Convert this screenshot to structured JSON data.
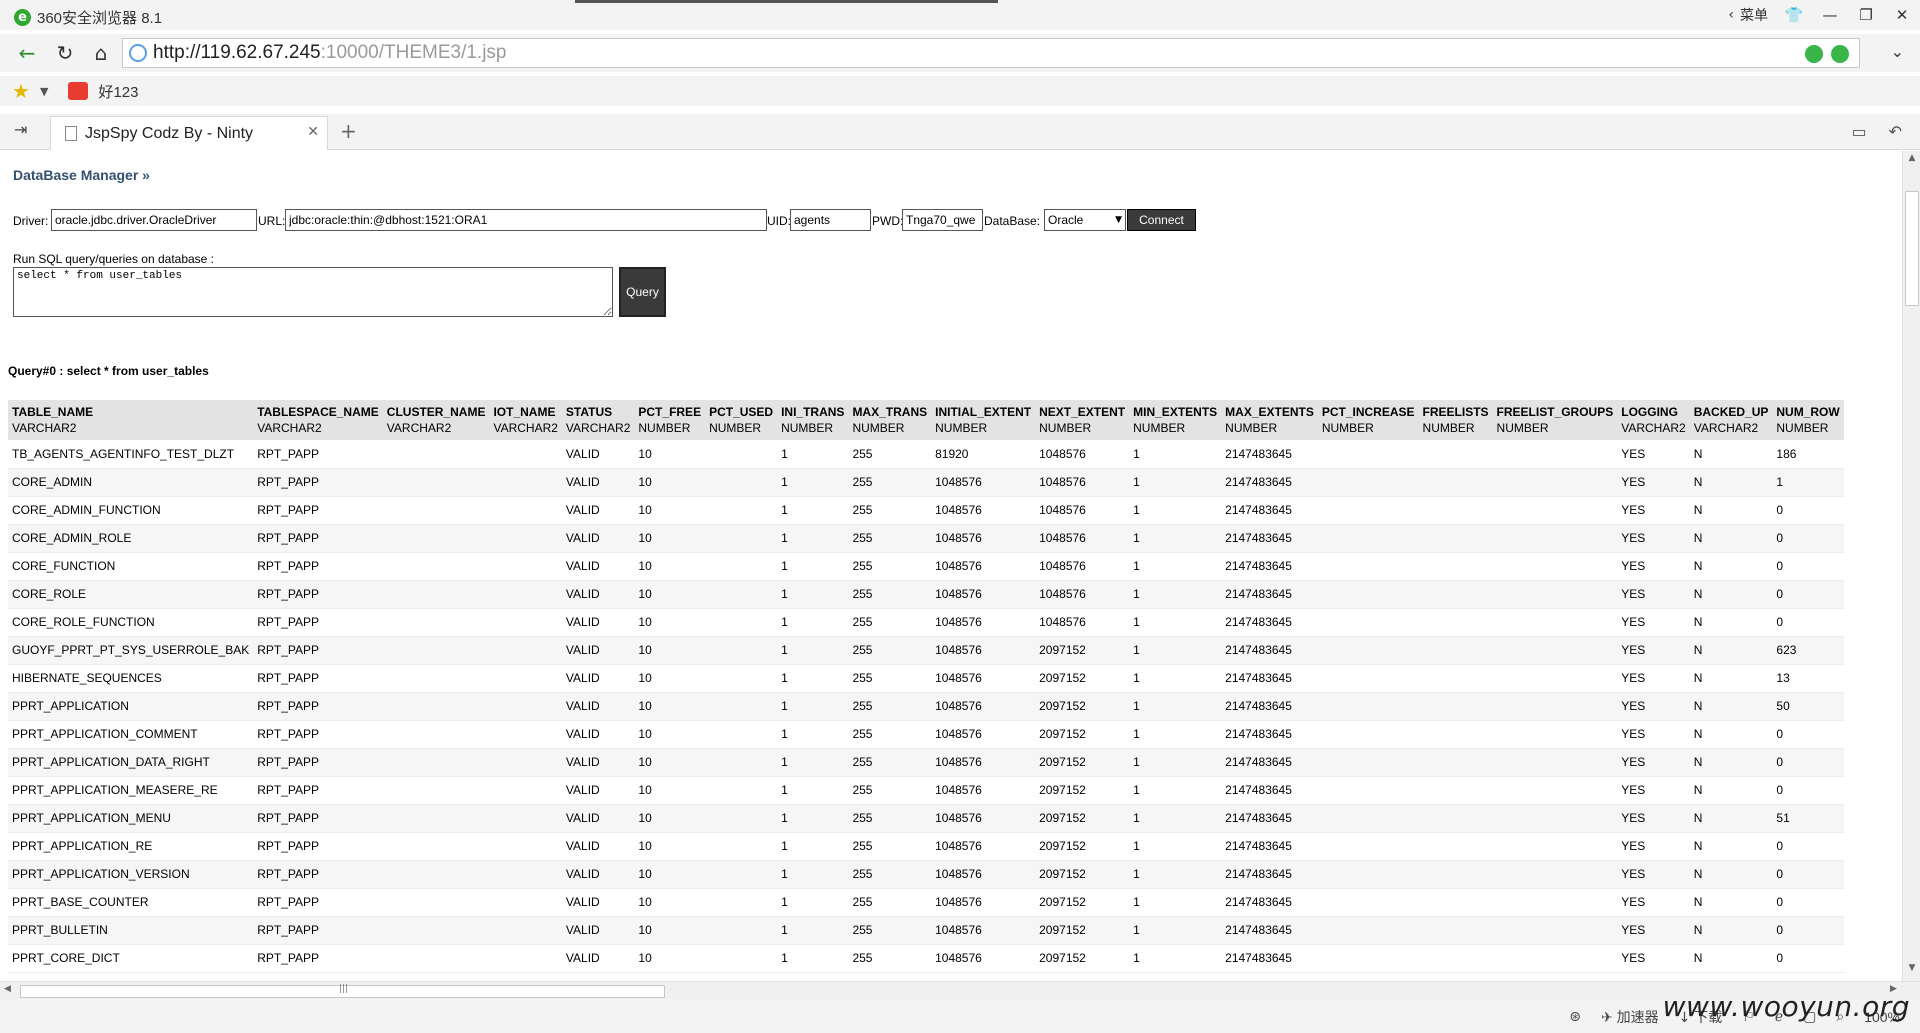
{
  "browser": {
    "title": "360安全浏览器 8.1",
    "menu_label": "菜单",
    "url_host": "http://119.62.67.245",
    "url_path": ":10000/THEME3/1.jsp",
    "fav_label": "好123",
    "tab_title": "JspSpy Codz By - Ninty",
    "status": {
      "accelerator": "加速器",
      "download": "下载",
      "zoom": "100%"
    },
    "watermark": "www.wooyun.org"
  },
  "page": {
    "title": "DataBase Manager »",
    "driver_label": "Driver:",
    "driver_value": "oracle.jdbc.driver.OracleDriver",
    "url_label": "URL:",
    "url_value": "jdbc:oracle:thin:@dbhost:1521:ORA1",
    "uid_label": "UID:",
    "uid_value": "agents",
    "pwd_label": "PWD:",
    "pwd_value": "Tnga70_qwe",
    "db_label": "DataBase:",
    "db_value": "Oracle",
    "connect_label": "Connect",
    "sql_label": "Run SQL query/queries on database :",
    "sql_value": "select * from user_tables",
    "query_label": "Query",
    "query_caption": "Query#0 : select * from user_tables"
  },
  "table": {
    "columns": [
      {
        "name": "TABLE_NAME",
        "type": "VARCHAR2"
      },
      {
        "name": "TABLESPACE_NAME",
        "type": "VARCHAR2"
      },
      {
        "name": "CLUSTER_NAME",
        "type": "VARCHAR2"
      },
      {
        "name": "IOT_NAME",
        "type": "VARCHAR2"
      },
      {
        "name": "STATUS",
        "type": "VARCHAR2"
      },
      {
        "name": "PCT_FREE",
        "type": "NUMBER"
      },
      {
        "name": "PCT_USED",
        "type": "NUMBER"
      },
      {
        "name": "INI_TRANS",
        "type": "NUMBER"
      },
      {
        "name": "MAX_TRANS",
        "type": "NUMBER"
      },
      {
        "name": "INITIAL_EXTENT",
        "type": "NUMBER"
      },
      {
        "name": "NEXT_EXTENT",
        "type": "NUMBER"
      },
      {
        "name": "MIN_EXTENTS",
        "type": "NUMBER"
      },
      {
        "name": "MAX_EXTENTS",
        "type": "NUMBER"
      },
      {
        "name": "PCT_INCREASE",
        "type": "NUMBER"
      },
      {
        "name": "FREELISTS",
        "type": "NUMBER"
      },
      {
        "name": "FREELIST_GROUPS",
        "type": "NUMBER"
      },
      {
        "name": "LOGGING",
        "type": "VARCHAR2"
      },
      {
        "name": "BACKED_UP",
        "type": "VARCHAR2"
      },
      {
        "name": "NUM_ROW",
        "type": "NUMBER"
      }
    ],
    "rows": [
      [
        "TB_AGENTS_AGENTINFO_TEST_DLZT",
        "RPT_PAPP",
        "",
        "",
        "VALID",
        "10",
        "",
        "1",
        "255",
        "81920",
        "1048576",
        "1",
        "2147483645",
        "",
        "",
        "",
        "YES",
        "N",
        "186"
      ],
      [
        "CORE_ADMIN",
        "RPT_PAPP",
        "",
        "",
        "VALID",
        "10",
        "",
        "1",
        "255",
        "1048576",
        "1048576",
        "1",
        "2147483645",
        "",
        "",
        "",
        "YES",
        "N",
        "1"
      ],
      [
        "CORE_ADMIN_FUNCTION",
        "RPT_PAPP",
        "",
        "",
        "VALID",
        "10",
        "",
        "1",
        "255",
        "1048576",
        "1048576",
        "1",
        "2147483645",
        "",
        "",
        "",
        "YES",
        "N",
        "0"
      ],
      [
        "CORE_ADMIN_ROLE",
        "RPT_PAPP",
        "",
        "",
        "VALID",
        "10",
        "",
        "1",
        "255",
        "1048576",
        "1048576",
        "1",
        "2147483645",
        "",
        "",
        "",
        "YES",
        "N",
        "0"
      ],
      [
        "CORE_FUNCTION",
        "RPT_PAPP",
        "",
        "",
        "VALID",
        "10",
        "",
        "1",
        "255",
        "1048576",
        "1048576",
        "1",
        "2147483645",
        "",
        "",
        "",
        "YES",
        "N",
        "0"
      ],
      [
        "CORE_ROLE",
        "RPT_PAPP",
        "",
        "",
        "VALID",
        "10",
        "",
        "1",
        "255",
        "1048576",
        "1048576",
        "1",
        "2147483645",
        "",
        "",
        "",
        "YES",
        "N",
        "0"
      ],
      [
        "CORE_ROLE_FUNCTION",
        "RPT_PAPP",
        "",
        "",
        "VALID",
        "10",
        "",
        "1",
        "255",
        "1048576",
        "1048576",
        "1",
        "2147483645",
        "",
        "",
        "",
        "YES",
        "N",
        "0"
      ],
      [
        "GUOYF_PPRT_PT_SYS_USERROLE_BAK",
        "RPT_PAPP",
        "",
        "",
        "VALID",
        "10",
        "",
        "1",
        "255",
        "1048576",
        "2097152",
        "1",
        "2147483645",
        "",
        "",
        "",
        "YES",
        "N",
        "623"
      ],
      [
        "HIBERNATE_SEQUENCES",
        "RPT_PAPP",
        "",
        "",
        "VALID",
        "10",
        "",
        "1",
        "255",
        "1048576",
        "2097152",
        "1",
        "2147483645",
        "",
        "",
        "",
        "YES",
        "N",
        "13"
      ],
      [
        "PPRT_APPLICATION",
        "RPT_PAPP",
        "",
        "",
        "VALID",
        "10",
        "",
        "1",
        "255",
        "1048576",
        "2097152",
        "1",
        "2147483645",
        "",
        "",
        "",
        "YES",
        "N",
        "50"
      ],
      [
        "PPRT_APPLICATION_COMMENT",
        "RPT_PAPP",
        "",
        "",
        "VALID",
        "10",
        "",
        "1",
        "255",
        "1048576",
        "2097152",
        "1",
        "2147483645",
        "",
        "",
        "",
        "YES",
        "N",
        "0"
      ],
      [
        "PPRT_APPLICATION_DATA_RIGHT",
        "RPT_PAPP",
        "",
        "",
        "VALID",
        "10",
        "",
        "1",
        "255",
        "1048576",
        "2097152",
        "1",
        "2147483645",
        "",
        "",
        "",
        "YES",
        "N",
        "0"
      ],
      [
        "PPRT_APPLICATION_MEASERE_RE",
        "RPT_PAPP",
        "",
        "",
        "VALID",
        "10",
        "",
        "1",
        "255",
        "1048576",
        "2097152",
        "1",
        "2147483645",
        "",
        "",
        "",
        "YES",
        "N",
        "0"
      ],
      [
        "PPRT_APPLICATION_MENU",
        "RPT_PAPP",
        "",
        "",
        "VALID",
        "10",
        "",
        "1",
        "255",
        "1048576",
        "2097152",
        "1",
        "2147483645",
        "",
        "",
        "",
        "YES",
        "N",
        "51"
      ],
      [
        "PPRT_APPLICATION_RE",
        "RPT_PAPP",
        "",
        "",
        "VALID",
        "10",
        "",
        "1",
        "255",
        "1048576",
        "2097152",
        "1",
        "2147483645",
        "",
        "",
        "",
        "YES",
        "N",
        "0"
      ],
      [
        "PPRT_APPLICATION_VERSION",
        "RPT_PAPP",
        "",
        "",
        "VALID",
        "10",
        "",
        "1",
        "255",
        "1048576",
        "2097152",
        "1",
        "2147483645",
        "",
        "",
        "",
        "YES",
        "N",
        "0"
      ],
      [
        "PPRT_BASE_COUNTER",
        "RPT_PAPP",
        "",
        "",
        "VALID",
        "10",
        "",
        "1",
        "255",
        "1048576",
        "2097152",
        "1",
        "2147483645",
        "",
        "",
        "",
        "YES",
        "N",
        "0"
      ],
      [
        "PPRT_BULLETIN",
        "RPT_PAPP",
        "",
        "",
        "VALID",
        "10",
        "",
        "1",
        "255",
        "1048576",
        "2097152",
        "1",
        "2147483645",
        "",
        "",
        "",
        "YES",
        "N",
        "0"
      ],
      [
        "PPRT_CORE_DICT",
        "RPT_PAPP",
        "",
        "",
        "VALID",
        "10",
        "",
        "1",
        "255",
        "1048576",
        "2097152",
        "1",
        "2147483645",
        "",
        "",
        "",
        "YES",
        "N",
        "0"
      ]
    ]
  }
}
